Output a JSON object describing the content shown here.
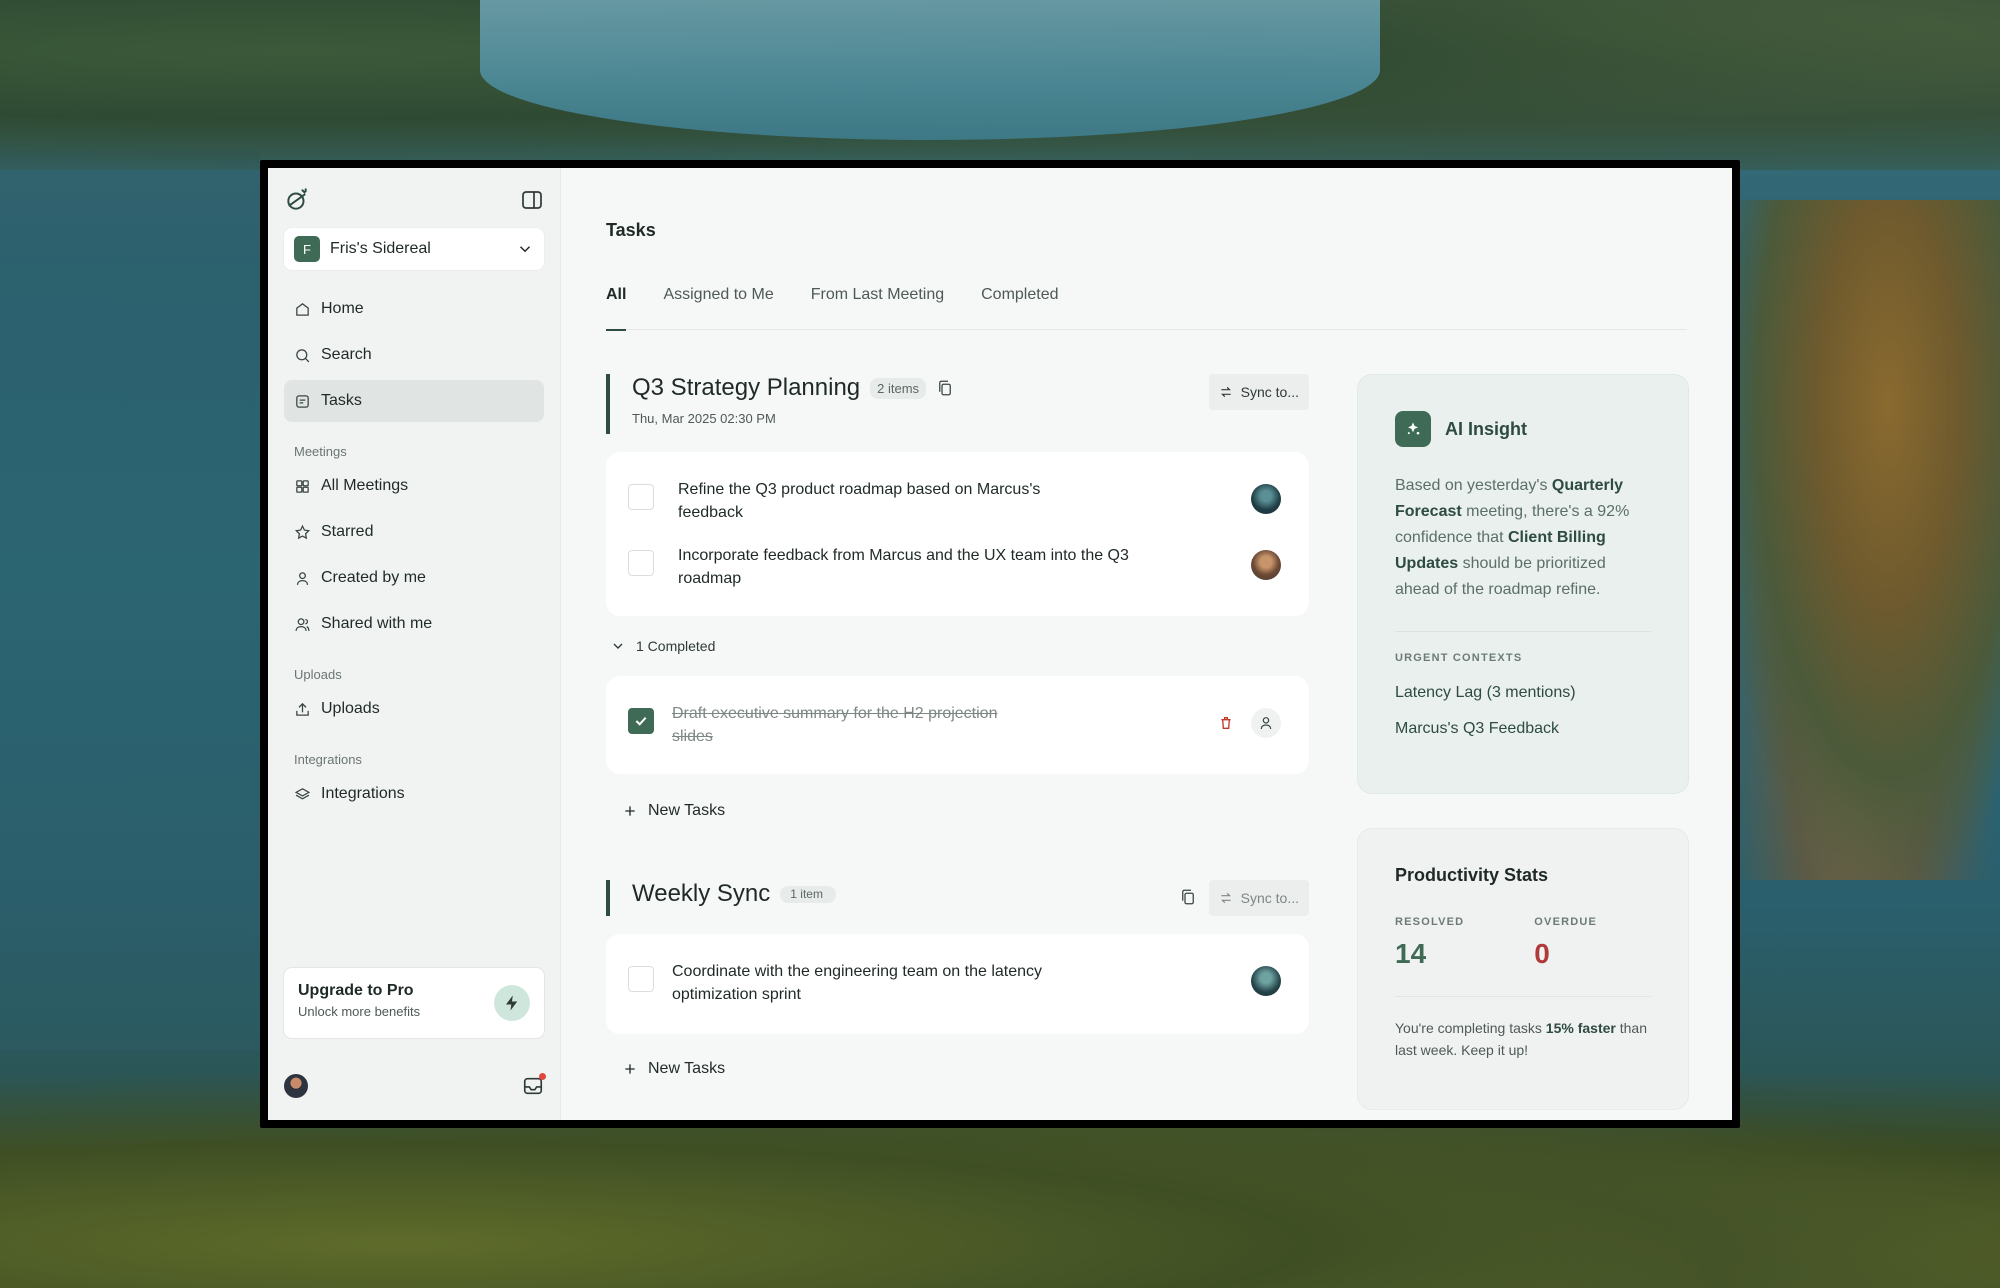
{
  "sidebar": {
    "workspace": {
      "initial": "F",
      "name": "Fris's Sidereal"
    },
    "nav": [
      {
        "label": "Home",
        "icon": "home-icon"
      },
      {
        "label": "Search",
        "icon": "search-icon"
      },
      {
        "label": "Tasks",
        "icon": "tasks-icon",
        "active": true
      }
    ],
    "meetings_label": "Meetings",
    "meetings": [
      {
        "label": "All Meetings",
        "icon": "grid-icon"
      },
      {
        "label": "Starred",
        "icon": "star-icon"
      },
      {
        "label": "Created by me",
        "icon": "user-icon"
      },
      {
        "label": "Shared with me",
        "icon": "users-icon"
      }
    ],
    "uploads_label": "Uploads",
    "uploads": [
      {
        "label": "Uploads",
        "icon": "upload-icon"
      }
    ],
    "integrations_label": "Integrations",
    "integrations": [
      {
        "label": "Integrations",
        "icon": "layers-icon"
      }
    ],
    "upgrade": {
      "title": "Upgrade to Pro",
      "subtitle": "Unlock more benefits"
    }
  },
  "main": {
    "title": "Tasks",
    "tabs": [
      {
        "label": "All",
        "active": true
      },
      {
        "label": "Assigned to Me"
      },
      {
        "label": "From Last Meeting"
      },
      {
        "label": "Completed"
      }
    ],
    "groups": [
      {
        "title": "Q3 Strategy Planning",
        "count": "2 items",
        "date": "Thu, Mar 2025 02:30 PM",
        "sync_label": "Sync to...",
        "tasks": [
          {
            "text": "Refine the Q3 product roadmap based on Marcus's feedback",
            "done": false
          },
          {
            "text": "Incorporate feedback from Marcus and the UX team into the Q3 roadmap",
            "done": false
          }
        ],
        "completed_toggle": "1 Completed",
        "completed_tasks": [
          {
            "text": "Draft executive summary for the H2 projection slides",
            "done": true
          }
        ],
        "new_tasks_label": "New Tasks"
      },
      {
        "title": "Weekly Sync",
        "count": "1 item",
        "sync_label": "Sync to...",
        "tasks": [
          {
            "text": "Coordinate with the engineering team on the latency optimization sprint",
            "done": false
          }
        ],
        "new_tasks_label": "New Tasks"
      }
    ]
  },
  "insight": {
    "title": "AI Insight",
    "body_parts": [
      "Based on yesterday's ",
      "Quarterly Forecast",
      " meeting, there's a 92% confidence that ",
      "Client Billing Updates",
      " should be prioritized ahead of the roadmap refine."
    ],
    "contexts_label": "URGENT CONTEXTS",
    "contexts": [
      "Latency Lag (3 mentions)",
      "Marcus's Q3 Feedback"
    ]
  },
  "stats": {
    "title": "Productivity Stats",
    "resolved_label": "RESOLVED",
    "resolved_value": "14",
    "overdue_label": "OVERDUE",
    "overdue_value": "0",
    "note_parts": [
      "You're completing tasks ",
      "15% faster",
      " than last week. Keep it up!"
    ]
  },
  "colors": {
    "accent": "#3e6a56",
    "danger": "#b03a3a",
    "badge_dot": "#e0463d"
  }
}
